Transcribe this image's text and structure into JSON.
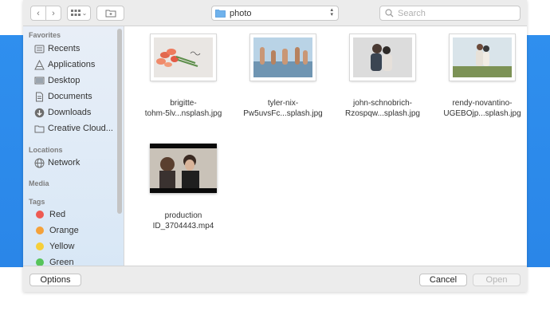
{
  "toolbar": {
    "path_label": "photo",
    "search_placeholder": "Search"
  },
  "sidebar": {
    "favorites_heading": "Favorites",
    "favorites": [
      {
        "label": "Recents",
        "icon": "recents-icon"
      },
      {
        "label": "Applications",
        "icon": "applications-icon"
      },
      {
        "label": "Desktop",
        "icon": "desktop-icon"
      },
      {
        "label": "Documents",
        "icon": "documents-icon"
      },
      {
        "label": "Downloads",
        "icon": "downloads-icon"
      },
      {
        "label": "Creative Cloud...",
        "icon": "folder-icon"
      }
    ],
    "locations_heading": "Locations",
    "locations": [
      {
        "label": "Network",
        "icon": "network-icon"
      }
    ],
    "media_heading": "Media",
    "tags_heading": "Tags",
    "tags": [
      {
        "label": "Red",
        "color": "#ee5a52"
      },
      {
        "label": "Orange",
        "color": "#f4a13a"
      },
      {
        "label": "Yellow",
        "color": "#f6cf3a"
      },
      {
        "label": "Green",
        "color": "#57c45b"
      }
    ]
  },
  "files": [
    {
      "line1": "brigitte-",
      "line2": "tohm-5lv...nsplash.jpg"
    },
    {
      "line1": "tyler-nix-",
      "line2": "Pw5uvsFc...splash.jpg"
    },
    {
      "line1": "john-schnobrich-",
      "line2": "Rzospqw...splash.jpg"
    },
    {
      "line1": "rendy-novantino-",
      "line2": "UGEBOjp...splash.jpg"
    },
    {
      "line1": "production",
      "line2": "ID_3704443.mp4"
    }
  ],
  "bottom": {
    "options_label": "Options",
    "cancel_label": "Cancel",
    "open_label": "Open"
  }
}
